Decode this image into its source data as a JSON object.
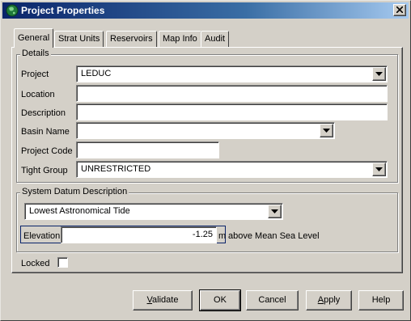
{
  "window": {
    "title": "Project Properties",
    "app_icon": "globe-icon",
    "close_icon": "close-icon"
  },
  "tabs": [
    {
      "label": "General",
      "active": true
    },
    {
      "label": "Strat Units",
      "active": false
    },
    {
      "label": "Reservoirs",
      "active": false
    },
    {
      "label": "Map Info",
      "active": false
    },
    {
      "label": "Audit",
      "active": false
    }
  ],
  "details": {
    "group_title": "Details",
    "project_label": "Project",
    "project_value": "LEDUC",
    "location_label": "Location",
    "location_value": "",
    "description_label": "Description",
    "description_value": "",
    "basin_label": "Basin Name",
    "basin_value": "",
    "project_code_label": "Project Code",
    "project_code_value": "",
    "tight_group_label": "Tight Group",
    "tight_group_value": "UNRESTRICTED"
  },
  "datum": {
    "group_title": "System Datum Description",
    "datum_value": "Lowest Astronomical Tide",
    "elevation_label": "Elevation",
    "elevation_value": "-1.25",
    "elevation_unit": "m",
    "elevation_suffix": "above Mean Sea Level"
  },
  "locked": {
    "label": "Locked",
    "checked": false
  },
  "buttons": {
    "validate_first": "V",
    "validate_rest": "alidate",
    "ok": "OK",
    "cancel": "Cancel",
    "apply_first": "A",
    "apply_rest": "pply",
    "help": "Help"
  }
}
